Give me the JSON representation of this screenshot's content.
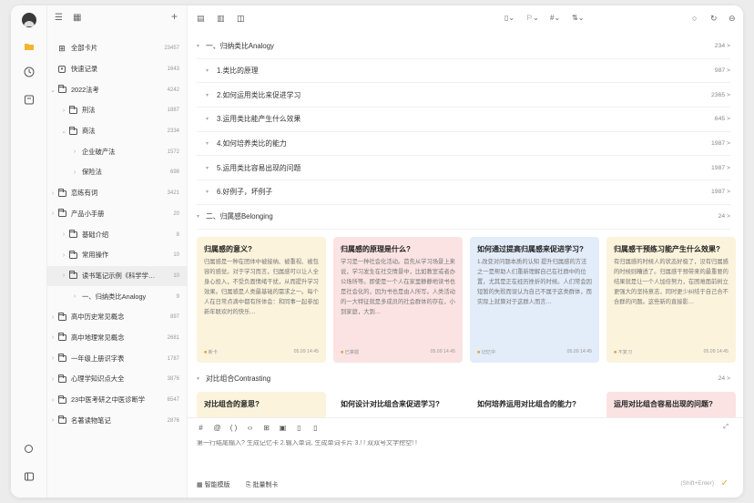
{
  "colors": {
    "card_yellow": "#fbf3dc",
    "card_pink": "#fbe3e3",
    "card_blue": "#e3ecf9",
    "accent": "#e6a640"
  },
  "sidebar": {
    "items": [
      {
        "label": "全部卡片",
        "count": "23457",
        "icon": "grid-icon"
      },
      {
        "label": "快速记录",
        "count": "1643",
        "icon": "inbox-icon"
      },
      {
        "label": "2022法考",
        "count": "4242",
        "icon": "folder-icon"
      },
      {
        "label": "刑法",
        "count": "1887",
        "icon": "folder-icon"
      },
      {
        "label": "商法",
        "count": "2334",
        "icon": "folder-icon"
      },
      {
        "label": "企业破产法",
        "count": "1572",
        "icon": ""
      },
      {
        "label": "保险法",
        "count": "698",
        "icon": ""
      },
      {
        "label": "恋练有词",
        "count": "3421",
        "icon": "folder-icon"
      },
      {
        "label": "产品小手册",
        "count": "20",
        "icon": "folder-icon"
      },
      {
        "label": "基础介绍",
        "count": "8",
        "icon": "folder-icon"
      },
      {
        "label": "常用操作",
        "count": "10",
        "icon": "folder-icon"
      },
      {
        "label": "读书笔记示例《科学学…",
        "count": "10",
        "icon": "folder-icon"
      },
      {
        "label": "一、归纳类比Analogy",
        "count": "9",
        "icon": ""
      },
      {
        "label": "高中历史常见概念",
        "count": "897",
        "icon": "folder-icon"
      },
      {
        "label": "高中地理常见概念",
        "count": "2681",
        "icon": "folder-icon"
      },
      {
        "label": "一年级上册识字表",
        "count": "1787",
        "icon": "folder-icon"
      },
      {
        "label": "心理学知识点大全",
        "count": "3876",
        "icon": "folder-icon"
      },
      {
        "label": "23中医考研之中医诊断学",
        "count": "6547",
        "icon": "folder-icon"
      },
      {
        "label": "名著读物笔记",
        "count": "2876",
        "icon": "folder-icon"
      }
    ]
  },
  "list": {
    "section1": {
      "title": "一、归纳类比Analogy",
      "count": "234 >"
    },
    "items": [
      {
        "title": "1.类比的原理",
        "count": "987 >"
      },
      {
        "title": "2.如何运用类比来促进学习",
        "count": "2365 >"
      },
      {
        "title": "3.运用类比能产生什么效果",
        "count": "645 >"
      },
      {
        "title": "4.如何培养类比的能力",
        "count": "1987 >"
      },
      {
        "title": "5.运用类比容易出现的问题",
        "count": "1987 >"
      },
      {
        "title": "6.好例子，坏例子",
        "count": "1987 >"
      }
    ],
    "section2": {
      "title": "二、归属感Belonging",
      "count": "24 >"
    },
    "section3": {
      "title": "对比组合Contrasting",
      "count": "24 >"
    }
  },
  "cards": [
    {
      "title": "归属感的意义?",
      "body": "归属感是一种在团体中被接纳、被重视、被包容的感觉。对于学习而言，归属感可以让人全身心投入，不受负面情绪干扰，从而提升学习效果。归属感是人类最基础的需求之一。每个人在日常点滴中都有所体会：和同事一起参加新年联欢时的快乐…",
      "tag": "新卡",
      "time": "05.09 14:45"
    },
    {
      "title": "归属感的原理是什么?",
      "body": "学习是一种社会化活动。首先从学习场景上来说，学习发生在社交情景中，比如教室或者办公场所等。即使是一个人在家里静静地读书也是社会化的，因为书也是由人所写。人类活动的一大特征就是多成员的社会群体的存在，小到家庭，大到…",
      "tag": "已掌握",
      "time": "05.09 14:45"
    },
    {
      "title": "如何通过提高归属感来促进学习?",
      "body": "1.改变对问题本质的认知\n提升归属感的方法之一是帮助人们重新理解自己在社群中的位置，尤其是正在经历挫折的时候。人们常会因短暂的失败而误认为自己不属于这类群体，而实际上就算对于这群人而言…",
      "tag": "记忆中",
      "time": "05.09 14:45"
    },
    {
      "title": "归属感干预练习能产生什么效果?",
      "body": "有归属感的时候人的状态好极了，没有归属感的时候则糟透了。归属感干预带来的最重要的结果就是让一个人加倍努力，在困难面前树立更强大的坚持意志，同时更少纠结于自己合不合群的问题。这些新的直接影…",
      "tag": "不复习",
      "time": "05.09 14:45"
    }
  ],
  "cards2": [
    {
      "title": "对比组合的意思?"
    },
    {
      "title": "如何设计对比组合来促进学习?"
    },
    {
      "title": "如何培养运用对比组合的能力?"
    },
    {
      "title": "运用对比组合容易出现的问题?"
    }
  ],
  "editor": {
    "placeholder": "第一行结尾输入? 生成记忆卡 2.输入单词, 生成单词卡片 3.! ! 双双号文字挖空! !",
    "template_button": "智能模版",
    "batch_button": "批量制卡",
    "hint": "(Shift+Enter)"
  }
}
